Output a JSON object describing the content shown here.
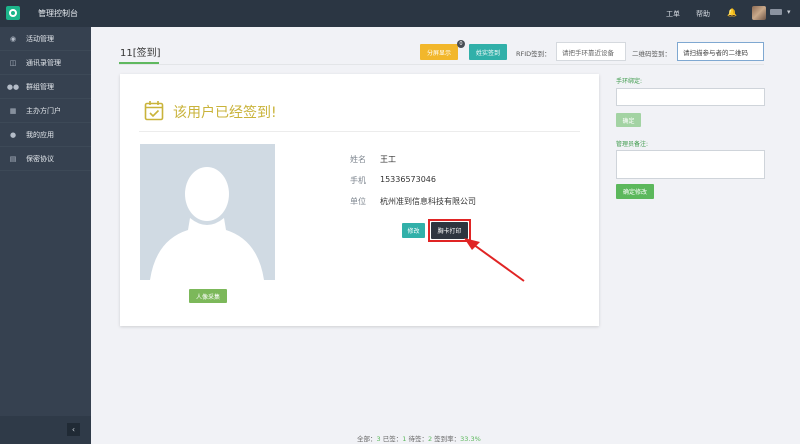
{
  "app": {
    "title": "管理控制台"
  },
  "topnav": {
    "item1": "工单",
    "item2": "帮助"
  },
  "sidebar": {
    "items": [
      {
        "label": "活动管理",
        "icon": "dashboard-icon"
      },
      {
        "label": "通讯录管理",
        "icon": "contacts-icon"
      },
      {
        "label": "群组管理",
        "icon": "group-icon"
      },
      {
        "label": "主办方门户",
        "icon": "portal-icon"
      },
      {
        "label": "我的应用",
        "icon": "app-icon"
      },
      {
        "label": "保密协议",
        "icon": "document-icon"
      }
    ],
    "collapse": "‹"
  },
  "header": {
    "title": "11[签到]",
    "screen_btn": "分屏显示",
    "badge": "0",
    "live_btn": "姓实签到",
    "rfid_label": "RFID签到：",
    "rfid_placeholder": "请把手环靠近设备",
    "qr_label": "二维码签到：",
    "qr_placeholder": "请扫描参与者的二维码"
  },
  "card": {
    "status_title": "该用户已经签到!",
    "fields": [
      {
        "label": "姓名",
        "value": "王工"
      },
      {
        "label": "手机",
        "value": "15336573046"
      },
      {
        "label": "单位",
        "value": "杭州准到信息科技有限公司"
      }
    ],
    "edit_btn": "修改",
    "print_btn": "胸卡打印",
    "photo_btn": "人像采集"
  },
  "right_panel": {
    "wristband_label": "手环绑定:",
    "confirm_btn": "确定",
    "remark_label": "管理员备注:",
    "confirm_edit_btn": "确定修改"
  },
  "stats": {
    "all_label": "全部：",
    "all": "3",
    "checked_label": "已签：",
    "checked": "1",
    "pending_label": "待签：",
    "pending": "2",
    "rate_label": "签到率：",
    "rate": "33.3%"
  },
  "colors": {
    "accent_green": "#5cb85c",
    "teal": "#31b0a9",
    "orange": "#f2b72b",
    "title_gold": "#c9b33a",
    "highlight_red": "#e02424"
  }
}
